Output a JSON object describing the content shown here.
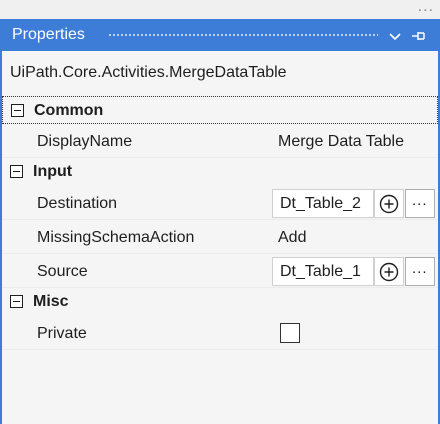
{
  "panel": {
    "title": "Properties",
    "activity_type": "UiPath.Core.Activities.MergeDataTable",
    "overflow_glyph": "...",
    "accent_color": "#3d7dd8"
  },
  "categories": {
    "common": {
      "name": "Common",
      "display_name_label": "DisplayName",
      "display_name_value": "Merge Data Table"
    },
    "input": {
      "name": "Input",
      "destination_label": "Destination",
      "destination_value": "Dt_Table_2",
      "missing_schema_label": "MissingSchemaAction",
      "missing_schema_value": "Add",
      "source_label": "Source",
      "source_value": "Dt_Table_1",
      "more_glyph": "..."
    },
    "misc": {
      "name": "Misc",
      "private_label": "Private",
      "private_checked": false
    }
  }
}
